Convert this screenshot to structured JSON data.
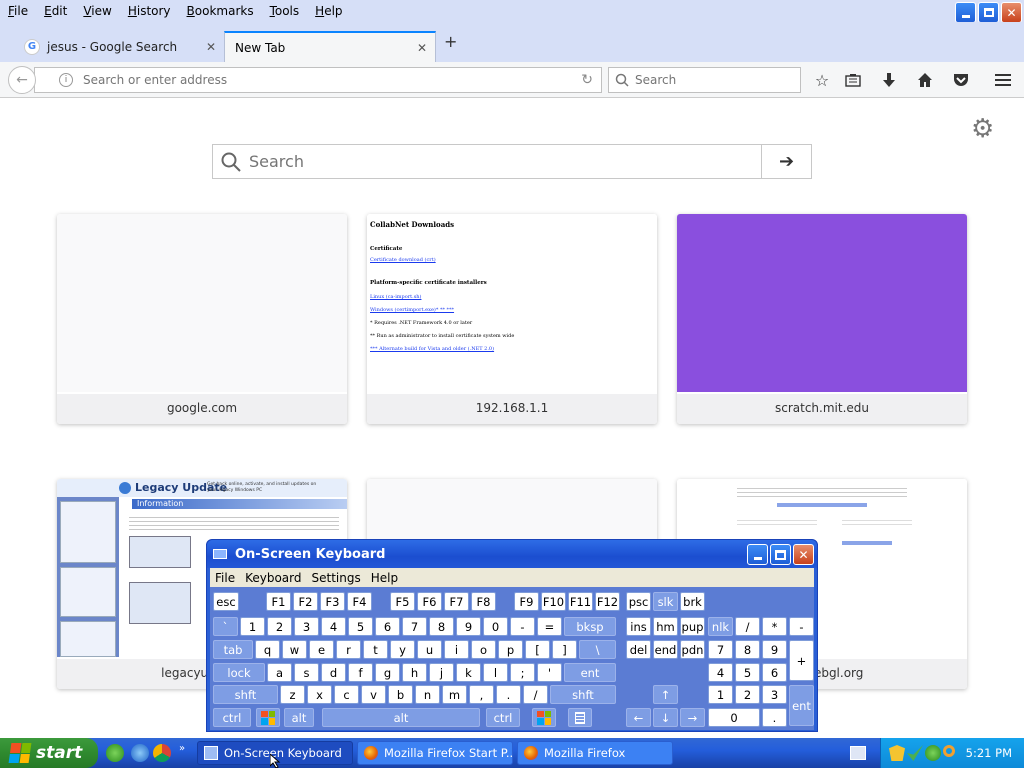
{
  "menubar": {
    "items": [
      "File",
      "Edit",
      "View",
      "History",
      "Bookmarks",
      "Tools",
      "Help"
    ]
  },
  "tabs": [
    {
      "title": "jesus - Google Search",
      "active": false
    },
    {
      "title": "New Tab",
      "active": true
    }
  ],
  "navbar": {
    "url_placeholder": "Search or enter address",
    "search_placeholder": "Search"
  },
  "newtab": {
    "search_placeholder": "Search",
    "tiles": [
      {
        "label": "google.com"
      },
      {
        "label": "192.168.1.1"
      },
      {
        "label": "scratch.mit.edu"
      },
      {
        "label": "legacyupdate"
      },
      {
        "label": ""
      },
      {
        "label": "get.webgl.org"
      }
    ],
    "collabnet": {
      "title": "CollabNet Downloads",
      "cert_heading": "Certificate",
      "cert_link": "Certificate download (crt)",
      "platform_heading": "Platform-specific certificate installers",
      "link1": "Linux (ca-import.sh)",
      "link2": "Windows (certimport.exe)* ** ***",
      "note1": "* Requires .NET Framework 4.0 or later",
      "note2": "** Run as administrator to install certificate system wide",
      "note3": "*** Alternate build for Vista and older (.NET 2.0)"
    },
    "legacy": {
      "title": "Legacy Update",
      "desc": "Get back online, activate, and install updates on your legacy Windows PC",
      "info": "Information"
    }
  },
  "osk": {
    "title": "On-Screen Keyboard",
    "menu": [
      "File",
      "Keyboard",
      "Settings",
      "Help"
    ],
    "row1": [
      "esc",
      "F1",
      "F2",
      "F3",
      "F4",
      "F5",
      "F6",
      "F7",
      "F8",
      "F9",
      "F10",
      "F11",
      "F12",
      "psc",
      "slk",
      "brk"
    ],
    "row2": [
      "`",
      "1",
      "2",
      "3",
      "4",
      "5",
      "6",
      "7",
      "8",
      "9",
      "0",
      "-",
      "=",
      "bksp",
      "ins",
      "hm",
      "pup",
      "nlk",
      "/",
      "*",
      "-"
    ],
    "row3": [
      "tab",
      "q",
      "w",
      "e",
      "r",
      "t",
      "y",
      "u",
      "i",
      "o",
      "p",
      "[",
      "]",
      "\\",
      "del",
      "end",
      "pdn",
      "7",
      "8",
      "9",
      "+"
    ],
    "row4": [
      "lock",
      "a",
      "s",
      "d",
      "f",
      "g",
      "h",
      "j",
      "k",
      "l",
      ";",
      "'",
      "ent",
      "4",
      "5",
      "6"
    ],
    "row5": [
      "shft",
      "z",
      "x",
      "c",
      "v",
      "b",
      "n",
      "m",
      ",",
      ".",
      "/",
      "shft",
      "↑",
      "1",
      "2",
      "3",
      "ent"
    ],
    "row6": [
      "ctrl",
      "alt",
      "alt",
      "ctrl",
      "←",
      "↓",
      "→",
      "0",
      "."
    ]
  },
  "taskbar": {
    "start_label": "start",
    "buttons": [
      {
        "label": "On-Screen Keyboard",
        "active": true
      },
      {
        "label": "Mozilla Firefox Start P...",
        "active": false
      },
      {
        "label": "Mozilla Firefox",
        "active": false
      }
    ],
    "clock": "5:21 PM"
  },
  "colors": {
    "firefox_chrome": "#d6dff7",
    "tab_accent": "#0a84ff",
    "scratch_tile": "#8a4fde",
    "xp_blue": "#245edb",
    "start_green": "#2f8a2f"
  }
}
